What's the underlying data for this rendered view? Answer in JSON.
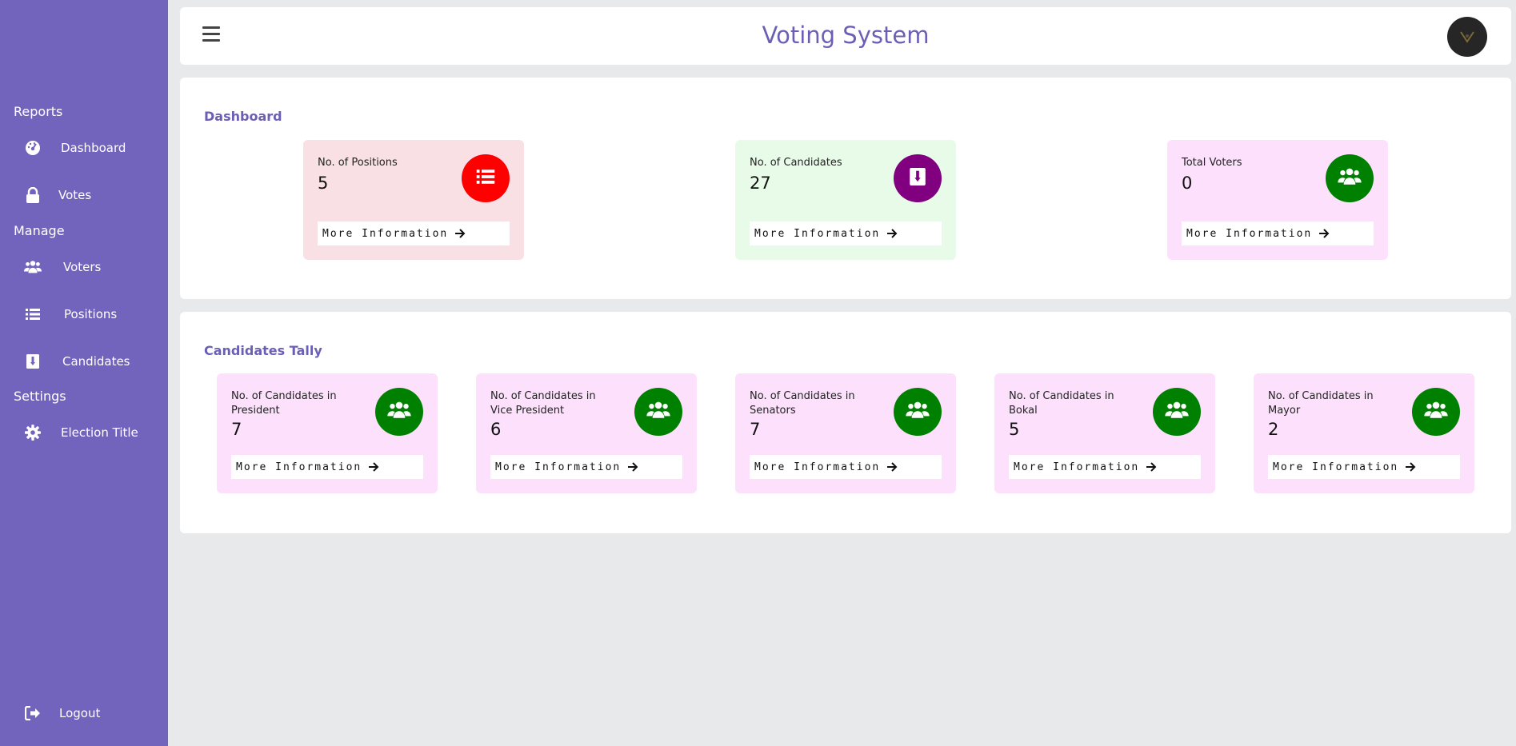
{
  "app": {
    "title": "Voting System"
  },
  "sidebar": {
    "sections": {
      "reports": "Reports",
      "manage": "Manage",
      "settings": "Settings"
    },
    "items": [
      {
        "label": "Dashboard",
        "icon": "dashboard-icon"
      },
      {
        "label": "Votes",
        "icon": "lock-icon"
      },
      {
        "label": "Voters",
        "icon": "users-icon"
      },
      {
        "label": "Positions",
        "icon": "list-icon"
      },
      {
        "label": "Candidates",
        "icon": "ballot-icon"
      },
      {
        "label": "Election Title",
        "icon": "gear-icon"
      }
    ],
    "logout": "Logout"
  },
  "dashboard": {
    "title": "Dashboard",
    "cards": [
      {
        "label": "No. of Positions",
        "value": "5",
        "more": "More Information",
        "bg": "#f9e0e4",
        "circle": "#ff0000",
        "icon": "list-icon"
      },
      {
        "label": "No. of Candidates",
        "value": "27",
        "more": "More Information",
        "bg": "#e8fbe8",
        "circle": "#800080",
        "icon": "ballot-icon"
      },
      {
        "label": "Total Voters",
        "value": "0",
        "more": "More Information",
        "bg": "#fce0fc",
        "circle": "#008000",
        "icon": "users-icon"
      }
    ]
  },
  "tally": {
    "title": "Candidates Tally",
    "cards": [
      {
        "label": "No. of Candidates in President",
        "value": "7",
        "more": "More Information"
      },
      {
        "label": "No. of Candidates in Vice President",
        "value": "6",
        "more": "More Information"
      },
      {
        "label": "No. of Candidates in Senators",
        "value": "7",
        "more": "More Information"
      },
      {
        "label": "No. of Candidates in Bokal",
        "value": "5",
        "more": "More Information"
      },
      {
        "label": "No. of Candidates in Mayor",
        "value": "2",
        "more": "More Information"
      }
    ],
    "bg": "#fce0fc",
    "circle": "#008000"
  }
}
